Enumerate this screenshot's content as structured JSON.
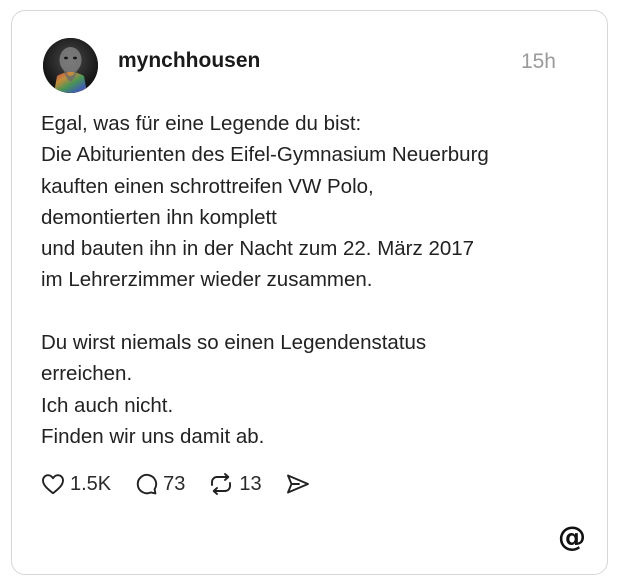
{
  "post": {
    "username": "mynchhousen",
    "timestamp": "15h",
    "lines": [
      "Egal, was für eine Legende du bist:",
      "Die Abiturienten des Eifel-Gymnasium Neuerburg",
      "kauften einen schrottreifen VW Polo,",
      "demontierten ihn komplett",
      "und bauten ihn in der Nacht zum 22. März 2017",
      "im Lehrerzimmer wieder zusammen.",
      "",
      "Du wirst niemals so einen Legendenstatus",
      "erreichen.",
      "Ich auch nicht.",
      "Finden wir uns damit ab."
    ]
  },
  "actions": {
    "likes": "1.5K",
    "comments": "73",
    "reposts": "13"
  },
  "icons": {
    "like": "heart-icon",
    "comment": "speech-bubble-icon",
    "repost": "repost-icon",
    "share": "send-icon",
    "brand": "threads-logo-icon"
  },
  "colors": {
    "text": "#222222",
    "muted": "#9a9a9a",
    "border": "#d7d7d7"
  }
}
